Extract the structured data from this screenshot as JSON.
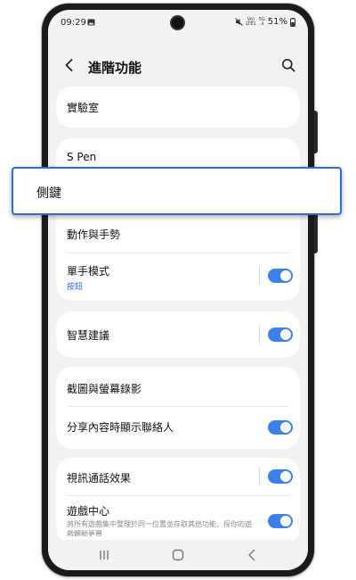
{
  "status_bar": {
    "time": "09:29",
    "volte": "Vo)\nLTE1",
    "network": "5G\n.ıl",
    "battery": "51%"
  },
  "header": {
    "title": "進階功能",
    "back_icon": "back-chevron-icon",
    "search_icon": "search-icon"
  },
  "items": {
    "lab": "實驗室",
    "spen": "S Pen",
    "side_key": "側鍵",
    "motions": "動作與手勢",
    "one_hand": "單手模式",
    "one_hand_sub": "按鈕",
    "smart_suggest": "智慧建議",
    "screenshot": "截圖與螢幕錄影",
    "share_contacts": "分享內容時顯示聯絡人",
    "video_effects": "視訊通話效果",
    "game_center": "遊戲中心",
    "game_center_desc": "將所有遊戲集中整理於同一位置並存取其他功能，探你的遊戲體驗更豐"
  },
  "toggles": {
    "one_hand": true,
    "smart_suggest": true,
    "share_contacts": true,
    "video_effects": true,
    "game_center": true
  },
  "colors": {
    "accent": "#3e80ea",
    "callout_border": "#2d6fcf",
    "background": "#f2f2f4"
  }
}
